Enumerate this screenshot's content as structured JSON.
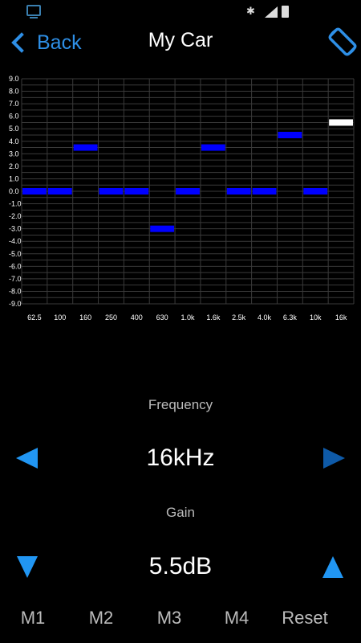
{
  "status_bar": {
    "app_icon": "monitor-icon",
    "bluetooth_icon": "bluetooth-icon",
    "signal_icon": "signal-icon",
    "battery_icon": "battery-icon"
  },
  "header": {
    "back_label": "Back",
    "title": "My Car",
    "rotate_icon": "screen-rotation-icon"
  },
  "colors": {
    "accent": "#2e8fe6",
    "eq_bar": "#0000ff",
    "eq_bar_selected": "#ffffff",
    "arrow": "#2196f3",
    "arrow_dim": "#0e5aa8"
  },
  "chart_data": {
    "type": "bar",
    "categories": [
      "62.5",
      "100",
      "160",
      "250",
      "400",
      "630",
      "1.0k",
      "1.6k",
      "2.5k",
      "4.0k",
      "6.3k",
      "10k",
      "16k"
    ],
    "values": [
      0.0,
      0.0,
      3.5,
      0.0,
      0.0,
      -3.0,
      0.0,
      3.5,
      0.0,
      0.0,
      4.5,
      0.0,
      5.5
    ],
    "selected_index": 12,
    "yticks": [
      "9.0",
      "8.0",
      "7.0",
      "6.0",
      "5.0",
      "4.0",
      "3.0",
      "2.0",
      "1.0",
      "0.0",
      "-1.0",
      "-2.0",
      "-3.0",
      "-4.0",
      "-5.0",
      "-6.0",
      "-7.0",
      "-8.0",
      "-9.0"
    ],
    "ylim": [
      -9,
      9
    ],
    "grid": true
  },
  "frequency": {
    "label": "Frequency",
    "value": "16kHz"
  },
  "gain": {
    "label": "Gain",
    "value": "5.5dB"
  },
  "presets": [
    "M1",
    "M2",
    "M3",
    "M4",
    "Reset"
  ]
}
